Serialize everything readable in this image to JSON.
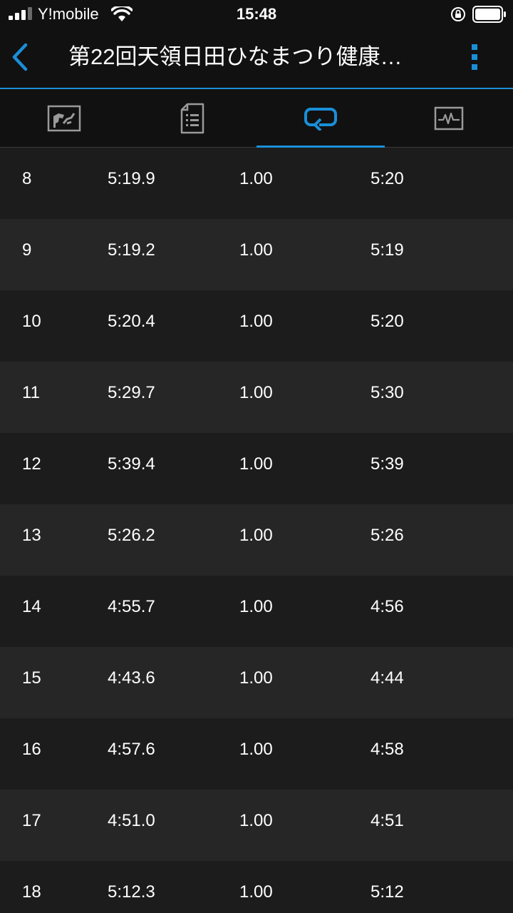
{
  "status_bar": {
    "carrier": "Y!mobile",
    "time": "15:48",
    "signal_bars": 4,
    "signal_bars_active": 3
  },
  "nav": {
    "title": "第22回天領日田ひなまつり健康…",
    "accent_color": "#1a8fd8"
  },
  "tabs": [
    {
      "icon": "map-icon",
      "active": false
    },
    {
      "icon": "summary-document-icon",
      "active": false
    },
    {
      "icon": "laps-repeat-icon",
      "active": true
    },
    {
      "icon": "chart-activity-icon",
      "active": false
    }
  ],
  "laps": [
    {
      "lap": "8",
      "time": "5:19.9",
      "distance": "1.00",
      "pace": "5:20"
    },
    {
      "lap": "9",
      "time": "5:19.2",
      "distance": "1.00",
      "pace": "5:19"
    },
    {
      "lap": "10",
      "time": "5:20.4",
      "distance": "1.00",
      "pace": "5:20"
    },
    {
      "lap": "11",
      "time": "5:29.7",
      "distance": "1.00",
      "pace": "5:30"
    },
    {
      "lap": "12",
      "time": "5:39.4",
      "distance": "1.00",
      "pace": "5:39"
    },
    {
      "lap": "13",
      "time": "5:26.2",
      "distance": "1.00",
      "pace": "5:26"
    },
    {
      "lap": "14",
      "time": "4:55.7",
      "distance": "1.00",
      "pace": "4:56"
    },
    {
      "lap": "15",
      "time": "4:43.6",
      "distance": "1.00",
      "pace": "4:44"
    },
    {
      "lap": "16",
      "time": "4:57.6",
      "distance": "1.00",
      "pace": "4:58"
    },
    {
      "lap": "17",
      "time": "4:51.0",
      "distance": "1.00",
      "pace": "4:51"
    },
    {
      "lap": "18",
      "time": "5:12.3",
      "distance": "1.00",
      "pace": "5:12"
    }
  ]
}
